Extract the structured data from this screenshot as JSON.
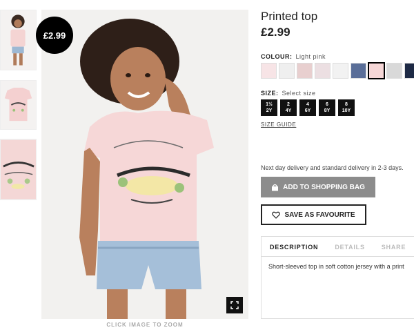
{
  "product": {
    "title": "Printed top",
    "price": "£2.99",
    "badge": "£2.99"
  },
  "colour": {
    "label": "COLOUR:",
    "selected": "Light pink",
    "swatches": [
      {
        "name": "eye-print-swatch",
        "color": "#f7e4e6"
      },
      {
        "name": "light-grey-swatch",
        "color": "#efefef"
      },
      {
        "name": "floral-print-swatch",
        "color": "#e8cfcf"
      },
      {
        "name": "bicycle-print-swatch",
        "color": "#ecdfe2"
      },
      {
        "name": "white-swatch",
        "color": "#f2f2f2"
      },
      {
        "name": "denim-blue-swatch",
        "color": "#5a6e98"
      },
      {
        "name": "light-pink-swatch",
        "color": "#f6d7d7"
      },
      {
        "name": "grey-melange-swatch",
        "color": "#d9d9d9"
      },
      {
        "name": "navy-dots-swatch",
        "color": "#1e2a45"
      }
    ]
  },
  "size": {
    "label": "SIZE:",
    "prompt": "Select size",
    "options": [
      "1½\n2Y",
      "2\n4Y",
      "4\n6Y",
      "6\n8Y",
      "8\n10Y"
    ],
    "guide": "SIZE GUIDE"
  },
  "delivery": "Next day delivery and standard delivery in 2-3 days.",
  "buttons": {
    "add_to_bag": "ADD TO SHOPPING BAG",
    "save_favourite": "SAVE AS FAVOURITE"
  },
  "tabs": {
    "items": [
      "DESCRIPTION",
      "DETAILS",
      "SHARE"
    ],
    "active": "DESCRIPTION",
    "description": "Short-sleeved top in soft cotton jersey with a print"
  },
  "zoom_caption": "CLICK IMAGE TO ZOOM",
  "colors": {
    "accent": "#000000",
    "button_grey": "#8c8c8c",
    "shirt_pink": "#f6d7d7"
  }
}
